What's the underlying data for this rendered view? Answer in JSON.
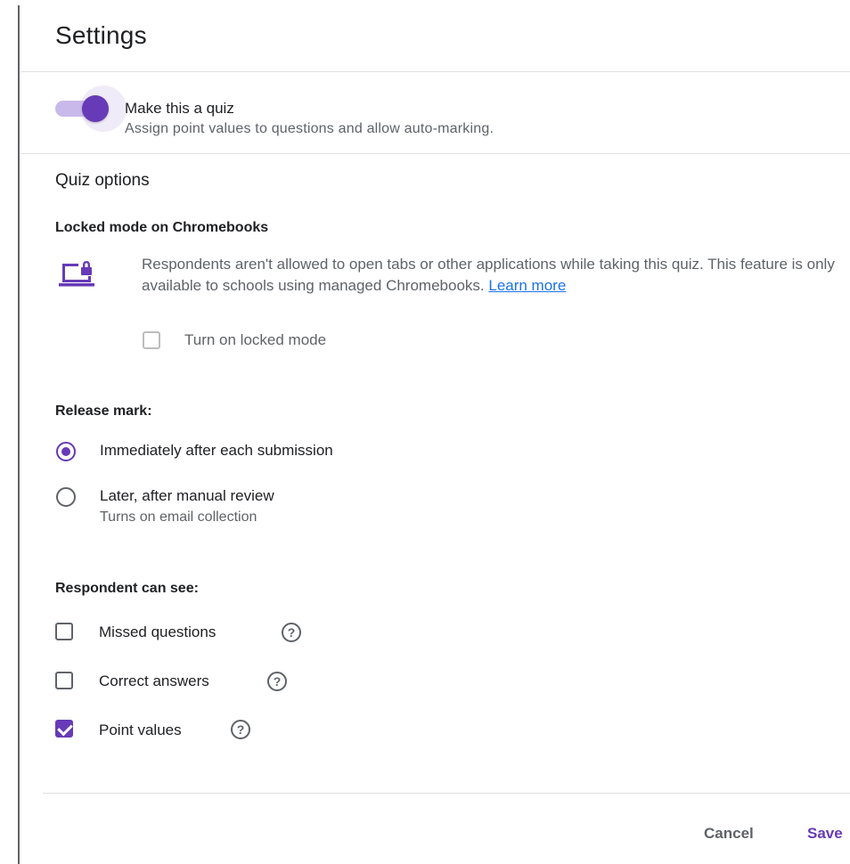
{
  "dialog": {
    "title": "Settings"
  },
  "quiz_toggle": {
    "label": "Make this a quiz",
    "description": "Assign point values to questions and allow auto-marking.",
    "on": true
  },
  "quiz_options": {
    "title": "Quiz options",
    "locked_mode": {
      "heading": "Locked mode on Chromebooks",
      "description": "Respondents aren't allowed to open tabs or other applications while taking this quiz. This feature is only available to schools using managed Chromebooks.",
      "learn_more": "Learn more",
      "checkbox_label": "Turn on locked mode",
      "checked": false,
      "icon": "locked-laptop-icon"
    },
    "release_mark": {
      "heading": "Release mark:",
      "options": [
        {
          "label": "Immediately after each submission",
          "sublabel": "",
          "selected": true
        },
        {
          "label": "Later, after manual review",
          "sublabel": "Turns on email collection",
          "selected": false
        }
      ]
    },
    "respondent_can_see": {
      "heading": "Respondent can see:",
      "items": [
        {
          "label": "Missed questions",
          "checked": false
        },
        {
          "label": "Correct answers",
          "checked": false
        },
        {
          "label": "Point values",
          "checked": true
        }
      ],
      "help_glyph": "?"
    }
  },
  "footer": {
    "cancel_label": "Cancel",
    "save_label": "Save"
  },
  "colors": {
    "accent": "#673ab7",
    "link": "#1a73e8",
    "text": "#202124",
    "secondary_text": "#5f6368"
  }
}
